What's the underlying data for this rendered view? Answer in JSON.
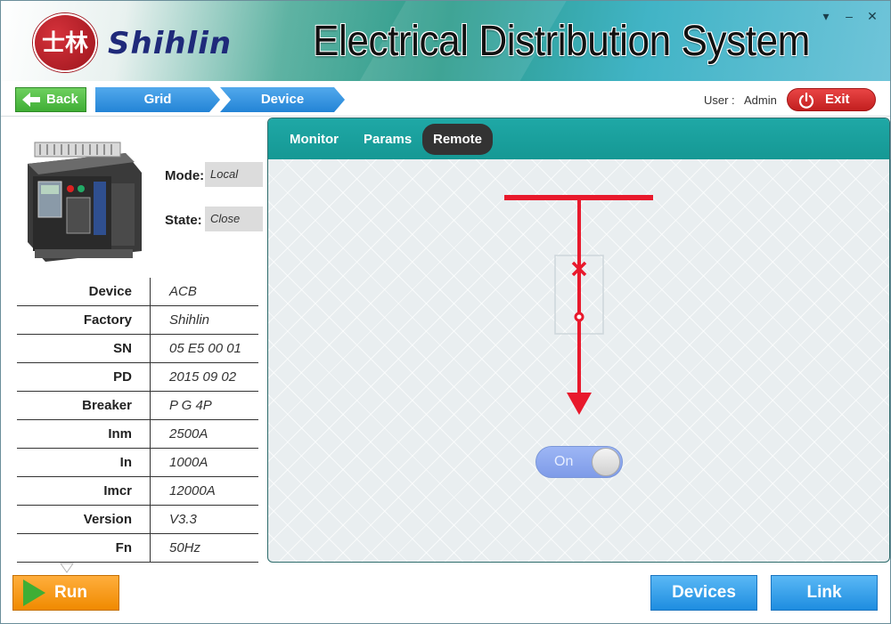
{
  "header": {
    "logo_text": "士林",
    "brand": "Shihlin",
    "title": "Electrical Distribution System",
    "window_controls": [
      "▾",
      "–",
      "✕"
    ]
  },
  "nav": {
    "back_label": "Back",
    "breadcrumbs": [
      "Grid",
      "Device"
    ],
    "user_label": "User :",
    "user_name": "Admin",
    "exit_label": "Exit"
  },
  "device": {
    "mode_label": "Mode:",
    "mode_value": "Local",
    "state_label": "State:",
    "state_value": "Close",
    "info": [
      {
        "key": "Device",
        "value": "ACB"
      },
      {
        "key": "Factory",
        "value": "Shihlin"
      },
      {
        "key": "SN",
        "value": "05 E5 00 01"
      },
      {
        "key": "PD",
        "value": "2015 09 02"
      },
      {
        "key": "Breaker",
        "value": "P G 4P"
      },
      {
        "key": "Inm",
        "value": "2500A"
      },
      {
        "key": "In",
        "value": "1000A"
      },
      {
        "key": "Imcr",
        "value": "12000A"
      },
      {
        "key": "Version",
        "value": "V3.3"
      },
      {
        "key": "Fn",
        "value": "50Hz"
      }
    ]
  },
  "tabs": [
    {
      "label": "Monitor",
      "active": false
    },
    {
      "label": "Params",
      "active": false
    },
    {
      "label": "Remote",
      "active": true
    }
  ],
  "remote": {
    "toggle_label": "On",
    "toggle_on": true,
    "line_color": "#e8192c"
  },
  "bottom": {
    "run_label": "Run",
    "devices_label": "Devices",
    "link_label": "Link"
  }
}
